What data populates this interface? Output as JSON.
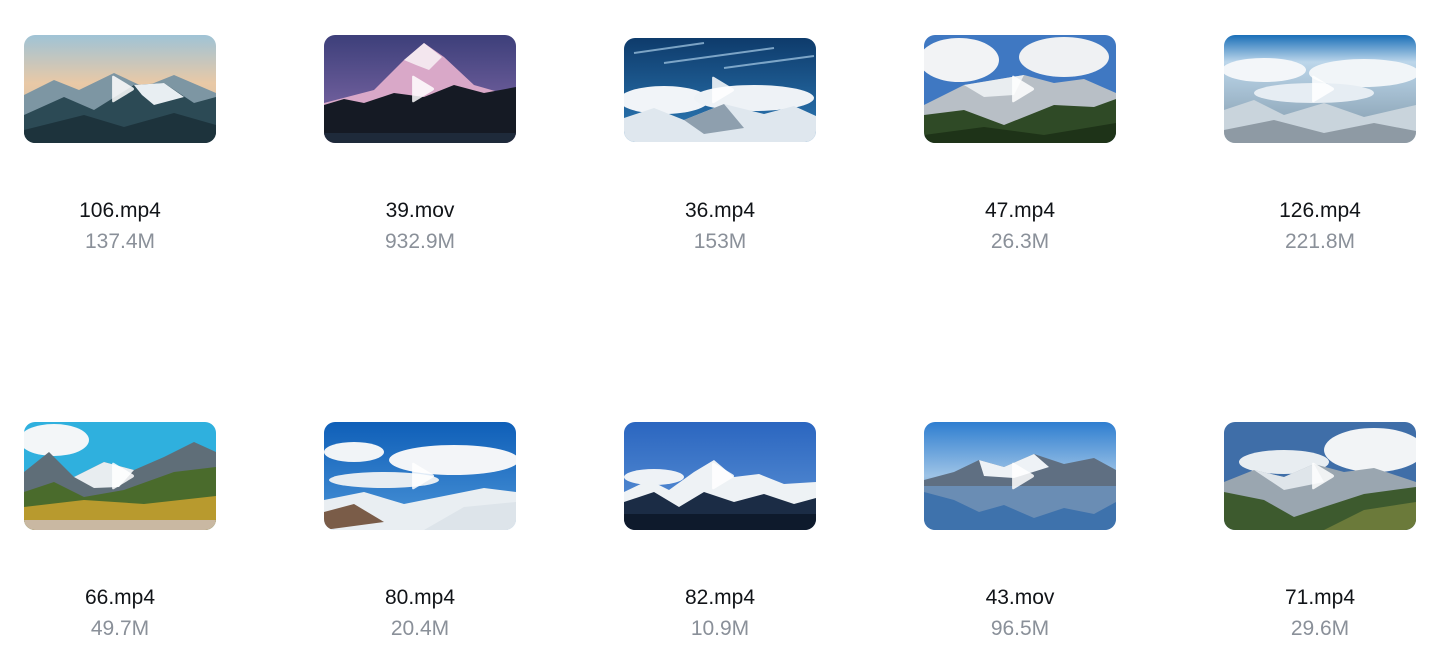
{
  "gallery": {
    "items": [
      {
        "name": "106.mp4",
        "size": "137.4M",
        "thumbnail": "mountain-dawn-peaks"
      },
      {
        "name": "39.mov",
        "size": "932.9M",
        "thumbnail": "snow-cone-mountain-dusk"
      },
      {
        "name": "36.mp4",
        "size": "153M",
        "thumbnail": "peaks-above-clouds"
      },
      {
        "name": "47.mp4",
        "size": "26.3M",
        "thumbnail": "cloudy-snow-ridge-forest"
      },
      {
        "name": "126.mp4",
        "size": "221.8M",
        "thumbnail": "aerial-cloud-range"
      },
      {
        "name": "66.mp4",
        "size": "49.7M",
        "thumbnail": "autumn-valley-peaks"
      },
      {
        "name": "80.mp4",
        "size": "20.4M",
        "thumbnail": "blue-sky-snow-slopes"
      },
      {
        "name": "82.mp4",
        "size": "10.9M",
        "thumbnail": "sharp-snow-peaks-blue"
      },
      {
        "name": "43.mov",
        "size": "96.5M",
        "thumbnail": "lake-reflection-mountains"
      },
      {
        "name": "71.mp4",
        "size": "29.6M",
        "thumbnail": "green-valley-cloud-peaks"
      }
    ],
    "play_icon": "play-icon"
  }
}
